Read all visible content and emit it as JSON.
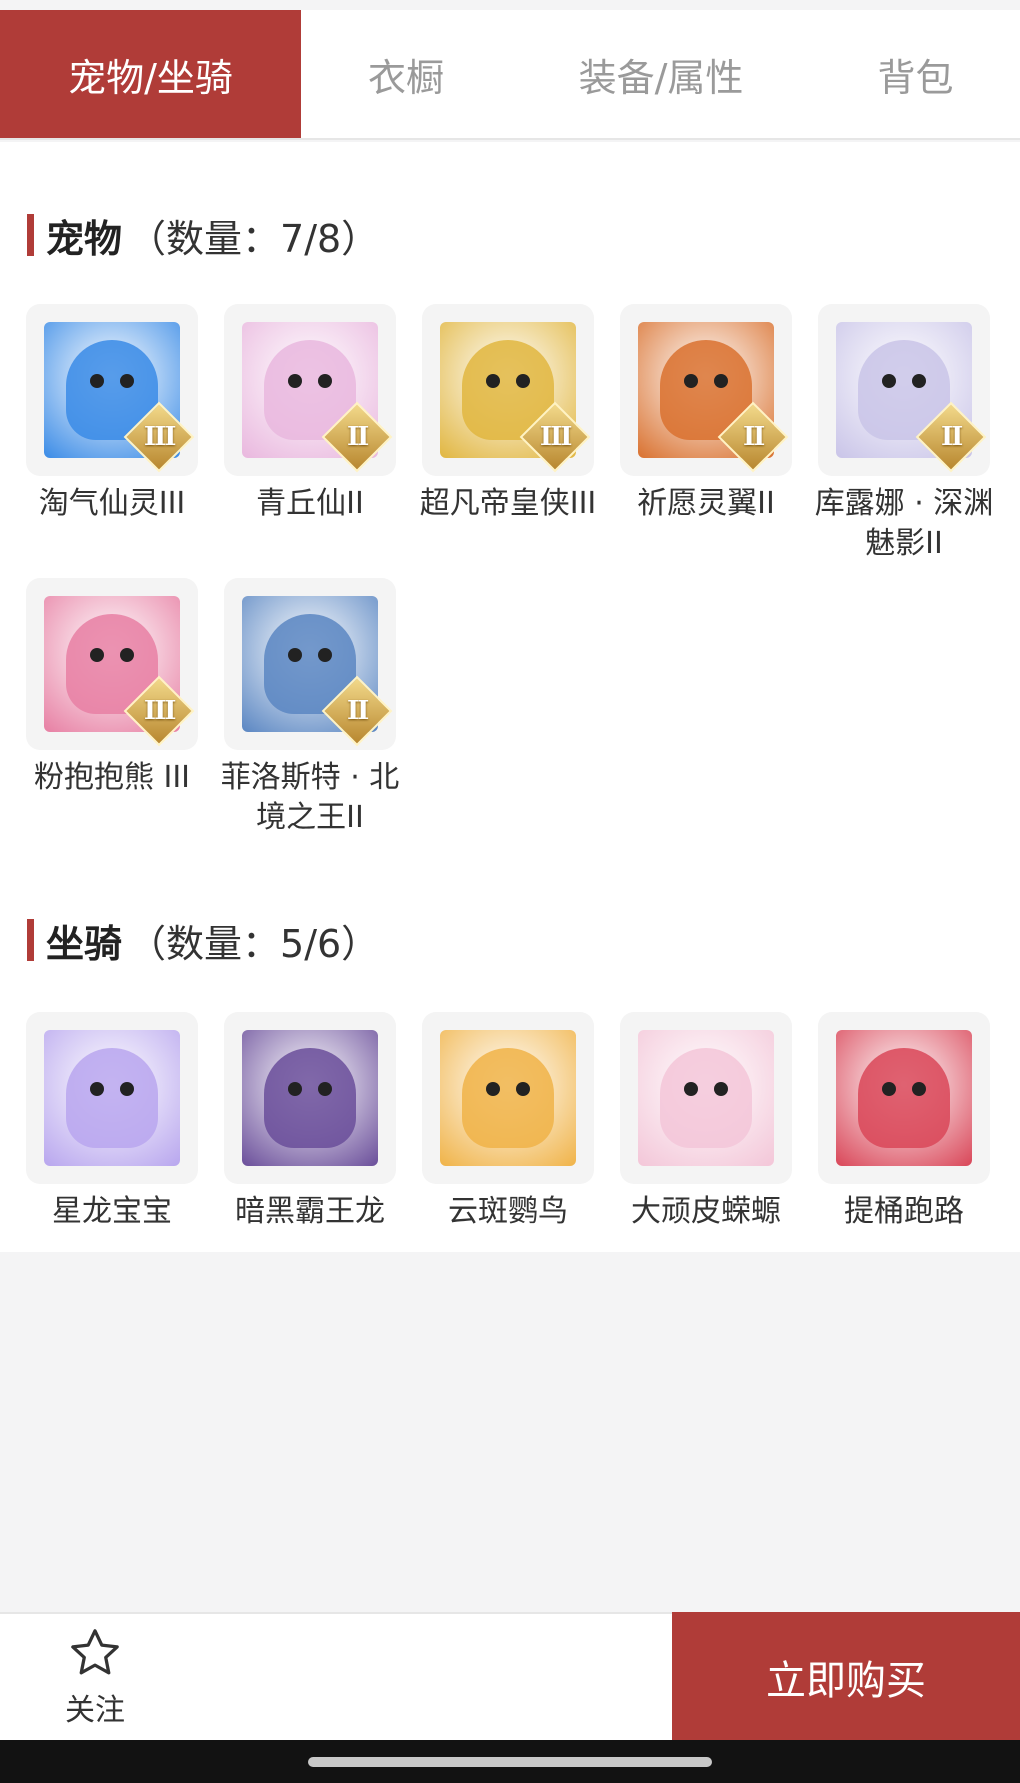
{
  "tabs": [
    {
      "label": "宠物/坐骑",
      "active": true
    },
    {
      "label": "衣橱",
      "active": false
    },
    {
      "label": "装备/属性",
      "active": false
    },
    {
      "label": "背包",
      "active": false
    }
  ],
  "pets": {
    "title": "宠物",
    "count": "（数量：7/8）",
    "items": [
      {
        "name": "淘气仙灵III",
        "grade": "III",
        "color": "#3a8be6"
      },
      {
        "name": "青丘仙II",
        "grade": "II",
        "color": "#e9b7de"
      },
      {
        "name": "超凡帝皇侠III",
        "grade": "III",
        "color": "#e1b640"
      },
      {
        "name": "祈愿灵翼II",
        "grade": "II",
        "color": "#d9712f"
      },
      {
        "name": "库露娜 · 深渊魅影II",
        "grade": "II",
        "color": "#c9c4e8"
      },
      {
        "name": "粉抱抱熊 III",
        "grade": "III",
        "color": "#e77fa3"
      },
      {
        "name": "菲洛斯特 · 北境之王II",
        "grade": "II",
        "color": "#5a86c2"
      }
    ]
  },
  "mounts": {
    "title": "坐骑",
    "count": "（数量：5/6）",
    "items": [
      {
        "name": "星龙宝宝",
        "color": "#b8a6ee"
      },
      {
        "name": "暗黑霸王龙",
        "color": "#6a4e9a"
      },
      {
        "name": "云斑鹦鸟",
        "color": "#f0b348"
      },
      {
        "name": "大顽皮蝾螈",
        "color": "#f3c6d8"
      },
      {
        "name": "提桶跑路",
        "color": "#d94658"
      }
    ]
  },
  "footer": {
    "follow_label": "关注",
    "buy_label": "立即购买"
  }
}
